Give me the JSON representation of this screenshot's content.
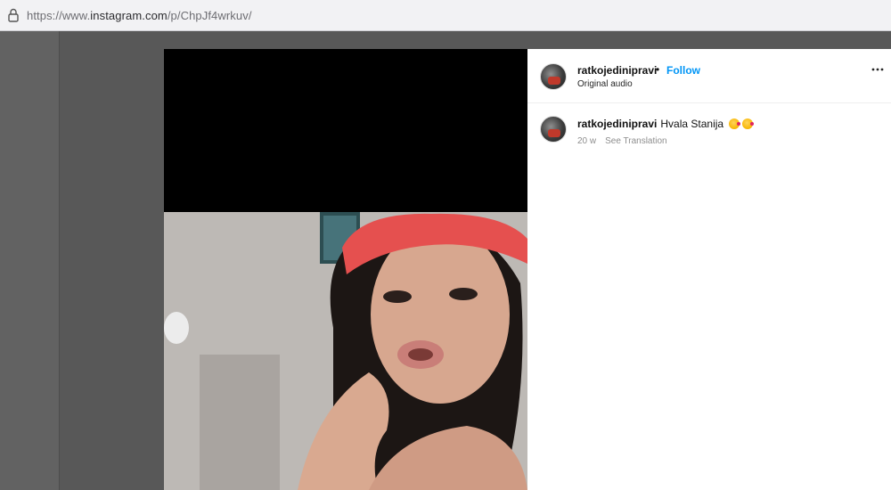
{
  "browser": {
    "url_prefix": "https://www.",
    "url_domain": "instagram.com",
    "url_path": "/p/ChpJf4wrkuv/",
    "lock_icon": "lock-icon"
  },
  "post": {
    "username": "ratkojedinipravi",
    "separator": "•",
    "follow_label": "Follow",
    "audio_label": "Original audio",
    "more_icon": "more-horizontal-icon"
  },
  "comment": {
    "username": "ratkojedinipravi",
    "text": "Hvala Stanija",
    "emojis": [
      "kissing-face-emoji",
      "kissing-face-emoji"
    ],
    "age": "20 w",
    "see_translation": "See Translation"
  }
}
